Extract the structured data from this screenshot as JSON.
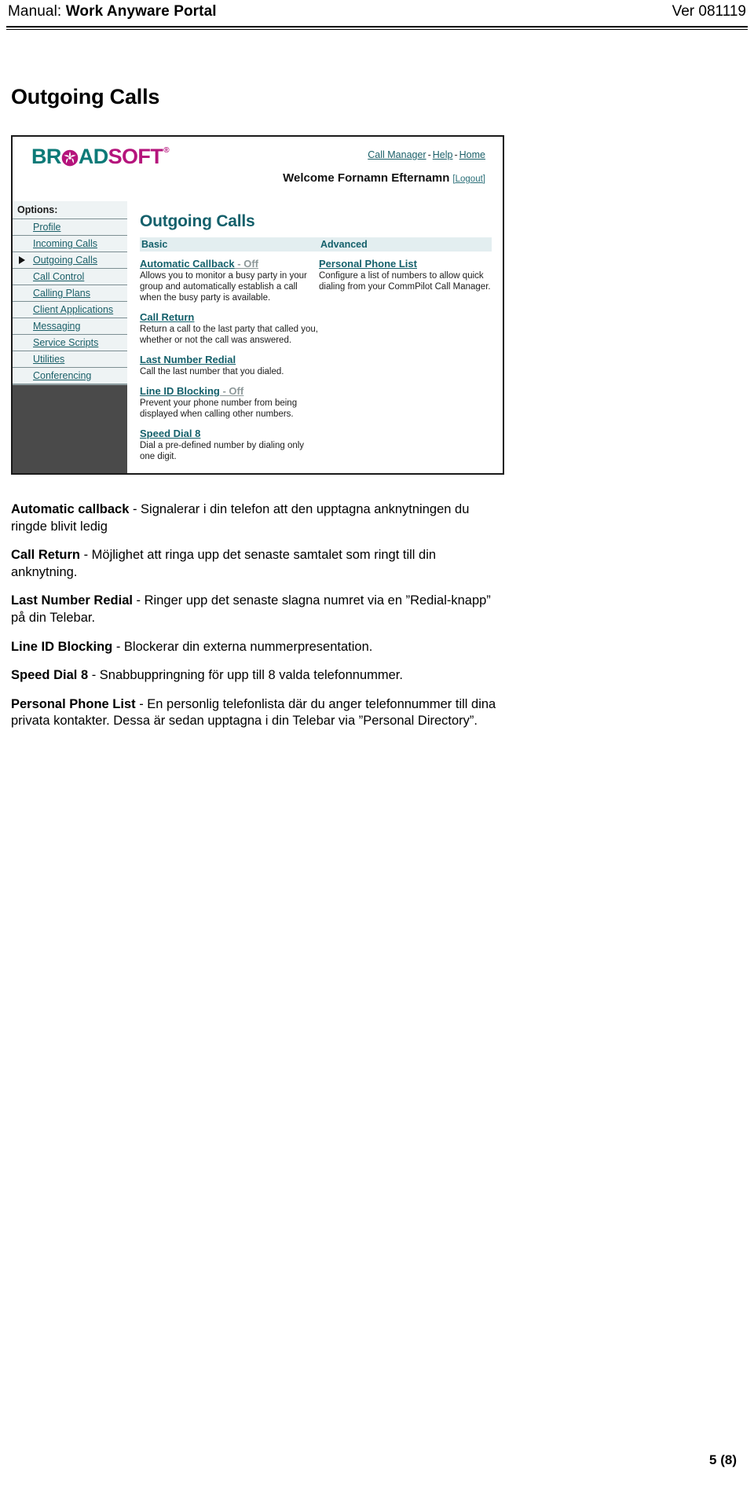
{
  "header": {
    "label": "Manual:",
    "title": "Work Anyware Portal",
    "version": "Ver 081119"
  },
  "doc_title": "Outgoing Calls",
  "screenshot": {
    "logo": {
      "part1": "BR",
      "mark": "pinwheel-mark",
      "part2": "AD",
      "part3": "SOFT",
      "registered": "®"
    },
    "topnav": {
      "items": [
        "Call Manager",
        "Help",
        "Home"
      ],
      "separator": "-"
    },
    "welcome": {
      "text": "Welcome Fornamn Efternamn",
      "logout": "[Logout]"
    },
    "sidebar": {
      "heading": "Options:",
      "items": [
        {
          "label": "Profile",
          "selected": false
        },
        {
          "label": "Incoming Calls",
          "selected": false
        },
        {
          "label": "Outgoing Calls",
          "selected": true
        },
        {
          "label": "Call Control",
          "selected": false
        },
        {
          "label": "Calling Plans",
          "selected": false
        },
        {
          "label": "Client Applications",
          "selected": false
        },
        {
          "label": "Messaging",
          "selected": false
        },
        {
          "label": "Service Scripts",
          "selected": false
        },
        {
          "label": "Utilities",
          "selected": false
        },
        {
          "label": "Conferencing",
          "selected": false
        }
      ]
    },
    "content": {
      "title": "Outgoing Calls",
      "columns": {
        "basic_header": "Basic",
        "advanced_header": "Advanced"
      },
      "basic_features": [
        {
          "name": "Automatic Callback",
          "state": " - Off",
          "desc": "Allows you to monitor a busy party in your group and automatically establish a call when the busy party is available."
        },
        {
          "name": "Call Return",
          "state": "",
          "desc": "Return a call to the last party that called you, whether or not the call was answered."
        },
        {
          "name": "Last Number Redial",
          "state": "",
          "desc": "Call the last number that you dialed."
        },
        {
          "name": "Line ID Blocking",
          "state": " - Off",
          "desc": "Prevent your phone number from being displayed when calling other numbers."
        },
        {
          "name": "Speed Dial 8",
          "state": "",
          "desc": "Dial a pre-defined number by dialing only one digit."
        }
      ],
      "advanced_features": [
        {
          "name": "Personal Phone List",
          "state": "",
          "desc": "Configure a list of numbers to allow quick dialing from your CommPilot Call Manager."
        }
      ]
    }
  },
  "body_paragraphs": [
    {
      "term": "Automatic callback",
      "rest": " - Signalerar i din telefon att den upptagna anknytningen du ringde blivit ledig"
    },
    {
      "term": "Call Return",
      "rest": " - Möjlighet att ringa upp det senaste samtalet som ringt till din anknytning."
    },
    {
      "term": "Last Number Redial",
      "rest": " - Ringer upp det senaste slagna numret via en ”Redial-knapp” på din Telebar."
    },
    {
      "term": "Line ID Blocking",
      "rest": " - Blockerar din externa nummerpresentation."
    },
    {
      "term": "Speed Dial 8",
      "rest": " - Snabbuppringning för upp till 8 valda telefonnummer."
    },
    {
      "term": "Personal Phone List",
      "rest": " - En personlig telefonlista där du anger telefonnummer till dina privata kontakter. Dessa är sedan upptagna i din Telebar via ”Personal Directory”."
    }
  ],
  "footer": {
    "page_number": "5 (8)"
  },
  "colors": {
    "brand_teal": "#0c7a78",
    "brand_magenta": "#b5147c",
    "link_teal": "#1a5f68",
    "heading_teal": "#14606b",
    "sidebar_dark": "#4a4a4a",
    "band_light": "#e3eef0"
  }
}
